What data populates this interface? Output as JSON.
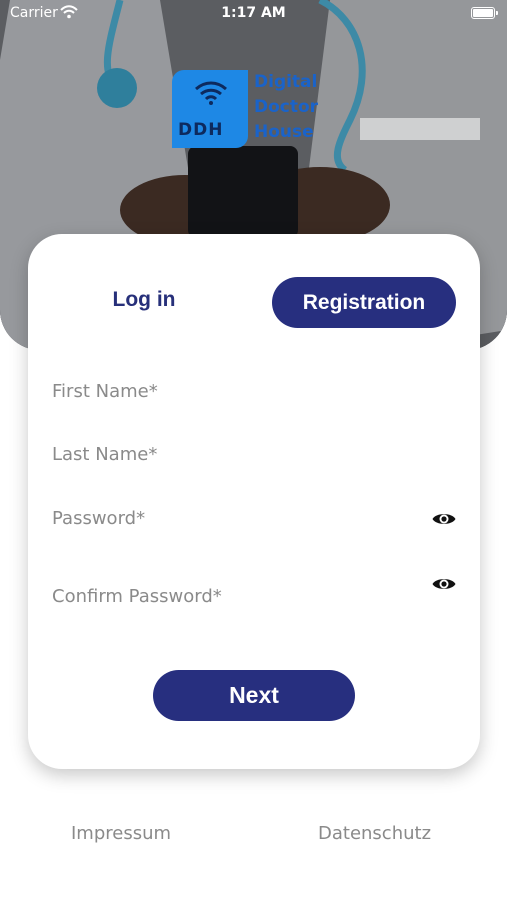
{
  "status_bar": {
    "carrier": "Carrier",
    "time": "1:17 AM",
    "icons": [
      "wifi-icon",
      "battery-icon"
    ]
  },
  "logo": {
    "abbreviation": "DDH",
    "words": [
      "Digital",
      "Doctor",
      "House"
    ],
    "mark_color": "#1e88e5",
    "text_color": "#1a63c9"
  },
  "tabs": {
    "login_label": "Log in",
    "registration_label": "Registration"
  },
  "form": {
    "first_name": {
      "placeholder": "First Name*",
      "value": ""
    },
    "last_name": {
      "placeholder": "Last Name*",
      "value": ""
    },
    "password": {
      "placeholder": "Password*",
      "value": "",
      "icon": "eye-icon"
    },
    "confirm_password": {
      "placeholder": "Confirm Password*",
      "value": "",
      "icon": "eye-icon"
    },
    "next_label": "Next"
  },
  "footer": {
    "impressum": "Impressum",
    "datenschutz": "Datenschutz"
  },
  "colors": {
    "primary": "#272f7f",
    "placeholder": "#8a8a8a",
    "card": "#ffffff"
  }
}
